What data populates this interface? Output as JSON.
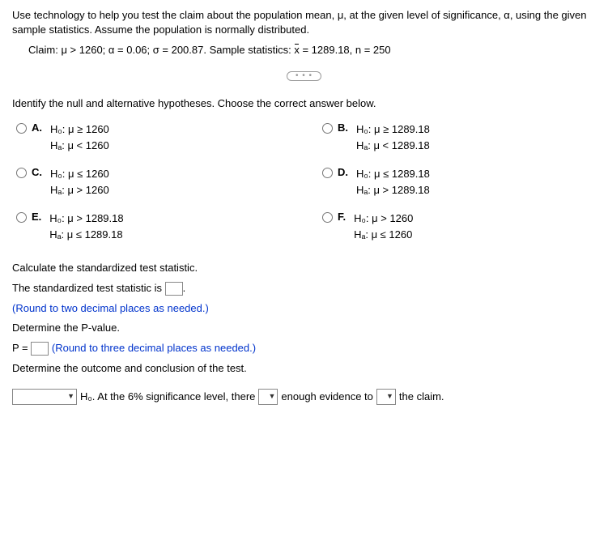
{
  "intro": {
    "line1": "Use technology to help you test the claim about the population mean, μ, at the given level of significance, α, using the given sample statistics. Assume the population is normally distributed.",
    "claim_prefix": "Claim: μ > 1260; α = 0.06; σ = 200.87. Sample statistics: ",
    "claim_xbar_label": "x",
    "claim_suffix": " = 1289.18, n = 250"
  },
  "divider": "• • •",
  "question": "Identify the null and alternative hypotheses. Choose the correct answer below.",
  "options": {
    "A": {
      "label": "A.",
      "h0": "H₀: μ ≥ 1260",
      "ha": "Hₐ: μ < 1260"
    },
    "B": {
      "label": "B.",
      "h0": "H₀: μ ≥ 1289.18",
      "ha": "Hₐ: μ < 1289.18"
    },
    "C": {
      "label": "C.",
      "h0": "H₀: μ ≤ 1260",
      "ha": "Hₐ: μ > 1260"
    },
    "D": {
      "label": "D.",
      "h0": "H₀: μ ≤ 1289.18",
      "ha": "Hₐ: μ > 1289.18"
    },
    "E": {
      "label": "E.",
      "h0": "H₀: μ > 1289.18",
      "ha": "Hₐ: μ ≤ 1289.18"
    },
    "F": {
      "label": "F.",
      "h0": "H₀: μ > 1260",
      "ha": "Hₐ: μ ≤ 1260"
    }
  },
  "calc": {
    "title": "Calculate the standardized test statistic.",
    "stat_prefix": "The standardized test statistic is ",
    "stat_suffix": ".",
    "stat_hint": "(Round to two decimal places as needed.)",
    "pvalue_title": "Determine the P-value.",
    "pvalue_prefix": "P = ",
    "pvalue_hint": " (Round to three decimal places as needed.)",
    "outcome_title": "Determine the outcome and conclusion of the test."
  },
  "conclusion": {
    "seg1": " H₀. At the 6% significance level, there ",
    "seg2": " enough evidence to ",
    "seg3": " the claim."
  }
}
